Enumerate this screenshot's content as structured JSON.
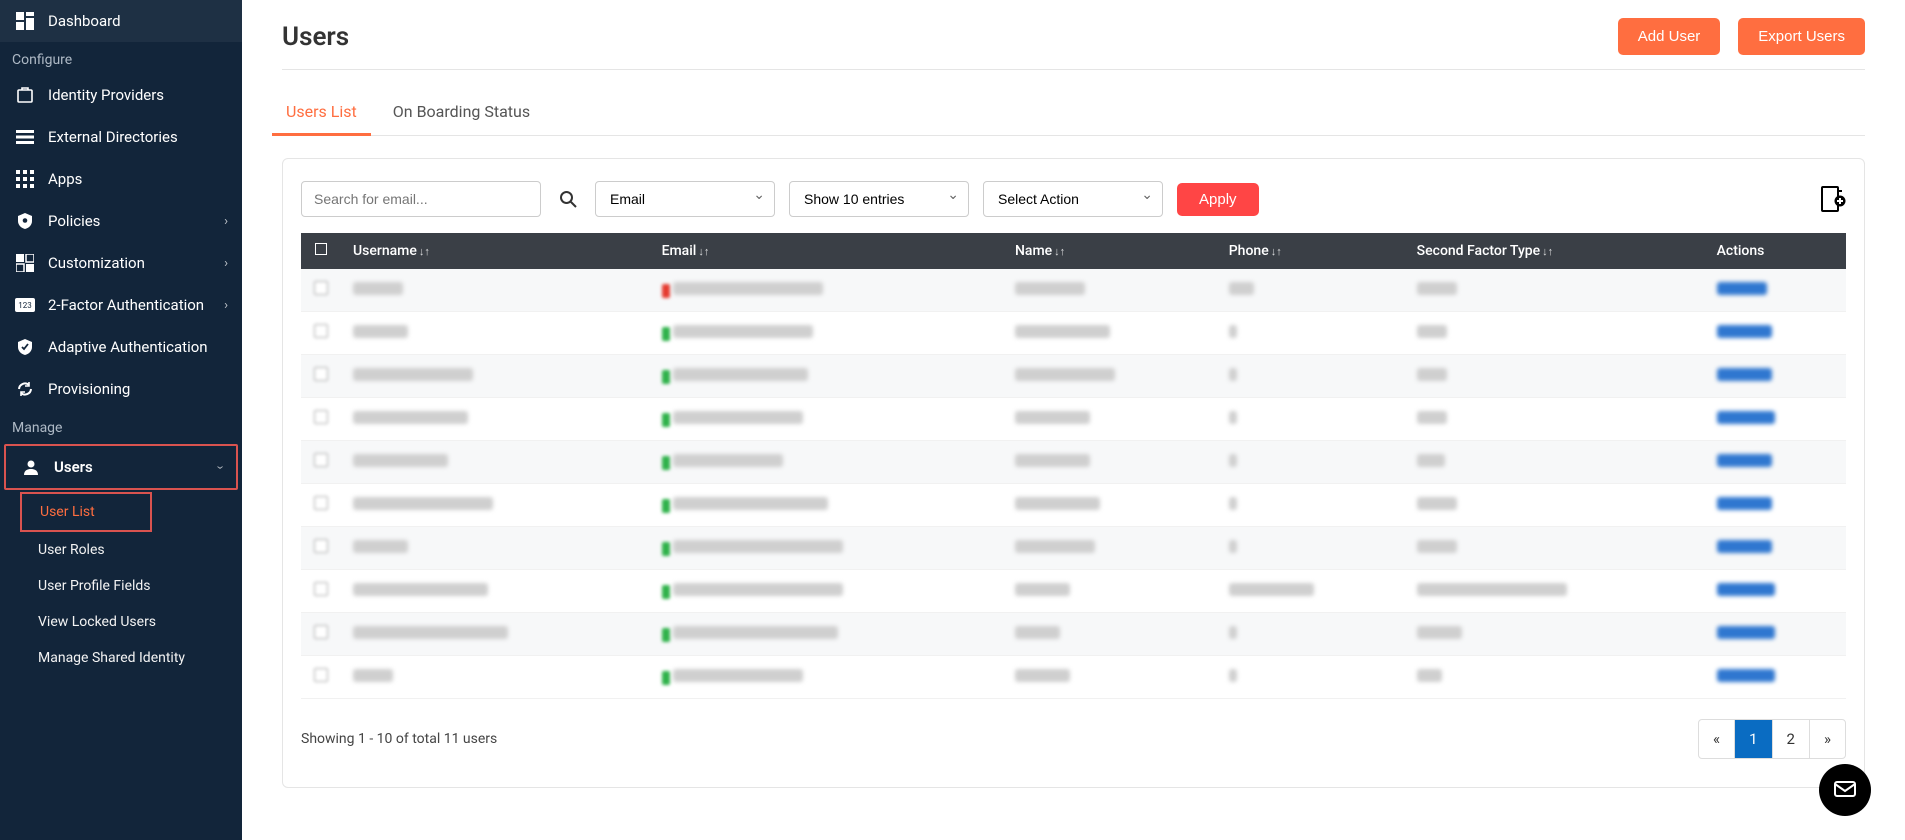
{
  "sidebar": {
    "items_top": [
      {
        "key": "dashboard",
        "label": "Dashboard",
        "icon": "dashboard"
      }
    ],
    "section_configure": "Configure",
    "items_configure": [
      {
        "key": "idp",
        "label": "Identity Providers",
        "icon": "idp"
      },
      {
        "key": "extdir",
        "label": "External Directories",
        "icon": "list"
      },
      {
        "key": "apps",
        "label": "Apps",
        "icon": "apps"
      },
      {
        "key": "policies",
        "label": "Policies",
        "icon": "shield-gear",
        "chev": true
      },
      {
        "key": "customization",
        "label": "Customization",
        "icon": "customize",
        "chev": true
      },
      {
        "key": "2fa",
        "label": "2-Factor Authentication",
        "icon": "123",
        "chev": true
      },
      {
        "key": "adaptive",
        "label": "Adaptive Authentication",
        "icon": "shield-check"
      },
      {
        "key": "provisioning",
        "label": "Provisioning",
        "icon": "sync"
      }
    ],
    "section_manage": "Manage",
    "users_label": "Users",
    "users_sub": [
      {
        "key": "userlist",
        "label": "User List",
        "highlight": true
      },
      {
        "key": "userroles",
        "label": "User Roles"
      },
      {
        "key": "profilefields",
        "label": "User Profile Fields"
      },
      {
        "key": "locked",
        "label": "View Locked Users"
      },
      {
        "key": "shared",
        "label": "Manage Shared Identity"
      }
    ]
  },
  "page": {
    "title": "Users",
    "add_user": "Add User",
    "export_users": "Export Users"
  },
  "tabs": [
    {
      "key": "list",
      "label": "Users List",
      "active": true
    },
    {
      "key": "onboard",
      "label": "On Boarding Status"
    }
  ],
  "toolbar": {
    "search_placeholder": "Search for email...",
    "filter_field": "Email",
    "page_size": "Show 10 entries",
    "action": "Select Action",
    "apply": "Apply"
  },
  "columns": [
    "Username",
    "Email",
    "Name",
    "Phone",
    "Second Factor Type",
    "Actions"
  ],
  "rows": [
    {
      "dot": "red",
      "u": 50,
      "e": 150,
      "n": 70,
      "p": 25,
      "s": 40,
      "a": 50
    },
    {
      "dot": "green",
      "u": 55,
      "e": 140,
      "n": 95,
      "p": 8,
      "s": 30,
      "a": 55
    },
    {
      "dot": "green",
      "u": 120,
      "e": 135,
      "n": 100,
      "p": 8,
      "s": 30,
      "a": 55
    },
    {
      "dot": "green",
      "u": 115,
      "e": 130,
      "n": 75,
      "p": 8,
      "s": 30,
      "a": 58
    },
    {
      "dot": "green",
      "u": 95,
      "e": 110,
      "n": 75,
      "p": 8,
      "s": 28,
      "a": 55
    },
    {
      "dot": "green",
      "u": 140,
      "e": 155,
      "n": 85,
      "p": 8,
      "s": 40,
      "a": 55
    },
    {
      "dot": "green",
      "u": 55,
      "e": 170,
      "n": 80,
      "p": 8,
      "s": 40,
      "a": 55
    },
    {
      "dot": "green",
      "u": 135,
      "e": 170,
      "n": 55,
      "p": 85,
      "s": 150,
      "a": 58
    },
    {
      "dot": "green",
      "u": 155,
      "e": 165,
      "n": 45,
      "p": 8,
      "s": 45,
      "a": 58
    },
    {
      "dot": "green",
      "u": 40,
      "e": 130,
      "n": 55,
      "p": 8,
      "s": 25,
      "a": 58
    }
  ],
  "footer": {
    "showing": "Showing 1 - 10 of total 11 users",
    "pages": [
      "«",
      "1",
      "2",
      "»"
    ],
    "active_page": "1"
  }
}
